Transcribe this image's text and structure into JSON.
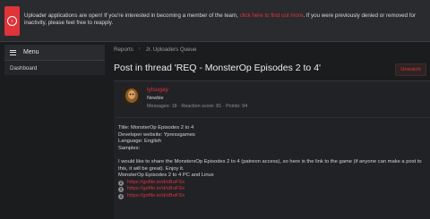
{
  "banner": {
    "text_before": "Uploader applications are open! If you're interested in becoming a member of the team,",
    "link": "click here to find out more",
    "text_after": ". If you were previously denied or removed for inactivity, please feel free to reapply.",
    "accent": "#e0333a"
  },
  "sidebar": {
    "menu_title": "Menu",
    "items": [
      {
        "label": "Dashboard"
      }
    ]
  },
  "breadcrumb": [
    "Reports",
    "Jr. Uploaders Queue"
  ],
  "thread": {
    "title": "Post in thread 'REQ - MonsterOp Episodes 2 to 4'",
    "unwatch_label": "Unwatch"
  },
  "post": {
    "username": "lytsugay",
    "role": "Newbie",
    "stats": "Messages: 18 · Reaction score: 81 · Points: 94",
    "lines": [
      "Title: MonsterOp Episodes 2 to 4",
      "Developer website: Ypressgames",
      "Language: English",
      "Samples:"
    ],
    "paragraph": "I would like to share the MonstersOp Episodes 2 to 4 (patreon access), so here is the link to the game (if anyone can make a post to this, it will be great). Enjoy it.",
    "subtitle": "MonsterOp Episodes 2 to 4 PC and Linux",
    "links": [
      {
        "num": "2",
        "url": "https://gofile.io/d/sBuFSx"
      },
      {
        "num": "3",
        "url": "https://gofile.io/d/sBuFSx"
      },
      {
        "num": "4",
        "url": "https://gofile.io/d/sBuFSx"
      }
    ]
  }
}
